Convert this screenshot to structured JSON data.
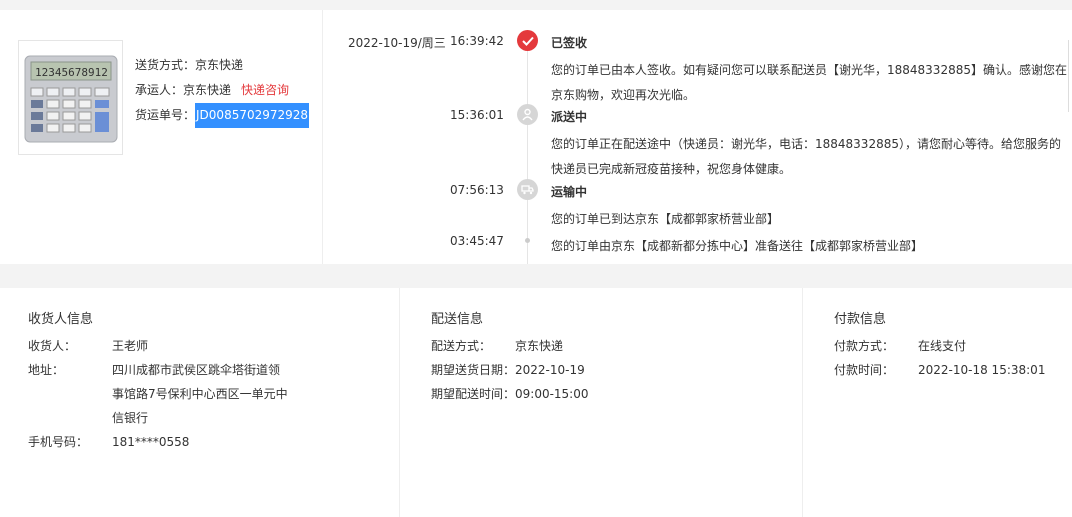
{
  "shipment": {
    "method_label": "送货方式：",
    "method_value": "京东快递",
    "carrier_label": "承运人：",
    "carrier_value": "京东快递",
    "consult_link": "快递咨询",
    "waybill_label": "货运单号：",
    "waybill_value": "JD0085702972928"
  },
  "timeline": [
    {
      "date": "2022-10-19/周三",
      "time": "16:39:42",
      "status": "已签收",
      "icon": "check-circle-icon",
      "desc": "您的订单已由本人签收。如有疑问您可以联系配送员【谢光华，18848332885】确认。感谢您在京东购物，欢迎再次光临。"
    },
    {
      "date": "",
      "time": "15:36:01",
      "status": "派送中",
      "icon": "courier-icon",
      "desc": "您的订单正在配送途中（快递员：谢光华，电话：18848332885），请您耐心等待。给您服务的快递员已完成新冠疫苗接种，祝您身体健康。"
    },
    {
      "date": "",
      "time": "07:56:13",
      "status": "运输中",
      "icon": "truck-icon",
      "desc": "您的订单已到达京东【成都郭家桥营业部】"
    },
    {
      "date": "",
      "time": "03:45:47",
      "status": "",
      "icon": "dot-icon",
      "desc": "您的订单由京东【成都新都分拣中心】准备送往【成都郭家桥营业部】"
    }
  ],
  "receiver": {
    "title": "收货人信息",
    "name_label": "收货人：",
    "name_value": "王老师",
    "address_label": "地址：",
    "address_value": "四川成都市武侯区跳伞塔街道领事馆路7号保利中心西区一单元中信银行",
    "phone_label": "手机号码：",
    "phone_value": "181****0558"
  },
  "delivery": {
    "title": "配送信息",
    "method_label": "配送方式：",
    "method_value": "京东快递",
    "date_label": "期望送货日期：",
    "date_value": "2022-10-19",
    "time_label": "期望配送时间：",
    "time_value": "09:00-15:00"
  },
  "payment": {
    "title": "付款信息",
    "method_label": "付款方式：",
    "method_value": "在线支付",
    "time_label": "付款时间：",
    "time_value": "2022-10-18 15:38:01"
  },
  "colors": {
    "accent": "#e4393c",
    "selection": "#3390ff",
    "grey_icon": "#d6d6d6"
  }
}
